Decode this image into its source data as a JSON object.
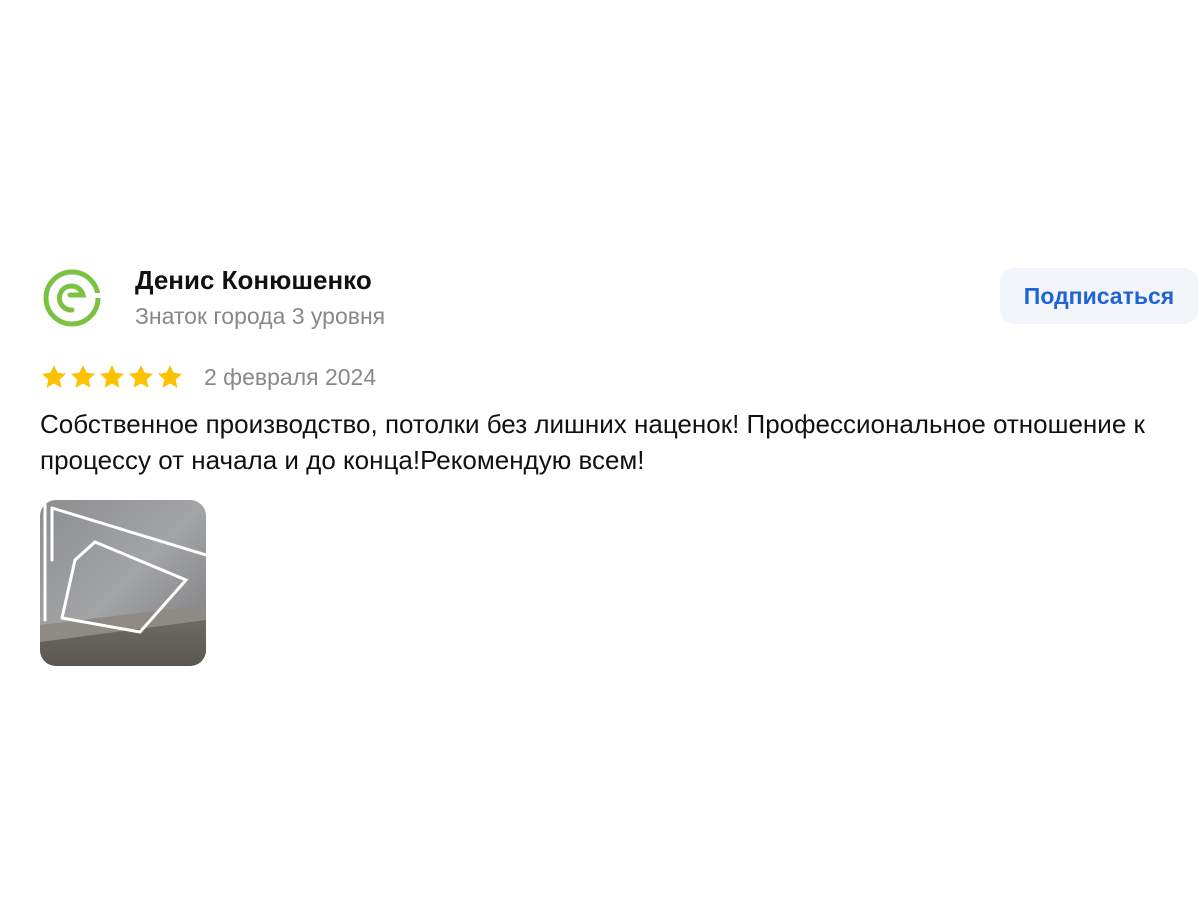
{
  "review": {
    "author": {
      "name": "Денис Конюшенко",
      "level": "Знаток города 3 уровня",
      "avatar_icon": "green-g-logo-icon",
      "avatar_color": "#7cc242"
    },
    "subscribe_label": "Подписаться",
    "rating": {
      "value": 5,
      "max": 5,
      "star_color": "#fcc200"
    },
    "date": "2 февраля 2024",
    "text": "Собственное производство, потолки без лишних наценок! Профессиональное отношение к процессу от начала и до конца!Рекомендую всем!",
    "photos": [
      {
        "icon": "ceiling-light-lines-photo"
      }
    ],
    "accent_color": "#1f63d6"
  }
}
